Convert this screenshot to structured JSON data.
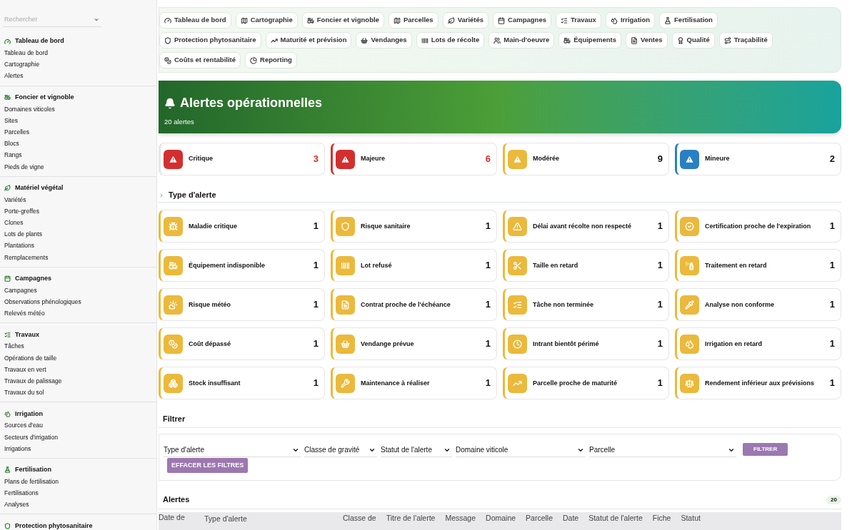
{
  "sidebar": {
    "search": {
      "placeholder": "Rechercher"
    },
    "sections": [
      {
        "title": "Tableau de bord",
        "items": [
          "Tableau de bord",
          "Cartographie",
          "Alertes"
        ]
      },
      {
        "title": "Foncier et vignoble",
        "items": [
          "Domaines viticoles",
          "Sites",
          "Parcelles",
          "Blocs",
          "Rangs",
          "Pieds de vigne"
        ]
      },
      {
        "title": "Matériel végétal",
        "items": [
          "Variétés",
          "Porte-greffes",
          "Clones",
          "Lots de plants",
          "Plantations",
          "Remplacements"
        ]
      },
      {
        "title": "Campagnes",
        "items": [
          "Campagnes",
          "Observations phénologiques",
          "Relevés météo"
        ]
      },
      {
        "title": "Travaux",
        "items": [
          "Tâches",
          "Opérations de taille",
          "Travaux en vert",
          "Travaux de palissage",
          "Travaux du sol"
        ]
      },
      {
        "title": "Irrigation",
        "items": [
          "Sources d'eau",
          "Secteurs d'irrigation",
          "Irrigations"
        ]
      },
      {
        "title": "Fertilisation",
        "items": [
          "Plans de fertilisation",
          "Fertilisations",
          "Analyses"
        ]
      },
      {
        "title": "Protection phytosanitaire"
      }
    ]
  },
  "nav": [
    "Tableau de bord",
    "Cartographie",
    "Foncier et vignoble",
    "Parcelles",
    "Variétés",
    "Campagnes",
    "Travaux",
    "Irrigation",
    "Fertilisation",
    "Protection phytosanitaire",
    "Maturité et prévision",
    "Vendanges",
    "Lots de récolte",
    "Main-d'oeuvre",
    "Équipements",
    "Ventes",
    "Qualité",
    "Traçabilité",
    "Coûts et rentabilité",
    "Reporting"
  ],
  "hero": {
    "title": "Alertes opérationnelles",
    "subtitle": "20 alertes"
  },
  "severities": [
    {
      "label": "Critique",
      "count": "3",
      "color": "#d32f2f",
      "highlighted": true
    },
    {
      "label": "Majeure",
      "count": "6",
      "color": "#d32f2f",
      "highlighted": true
    },
    {
      "label": "Modérée",
      "count": "9",
      "color": "#ebb93b",
      "highlighted": false
    },
    {
      "label": "Mineure",
      "count": "2",
      "color": "#2a7fc4",
      "highlighted": false
    }
  ],
  "types_heading": "Type d'alerte",
  "alert_types": [
    {
      "label": "Maladie critique",
      "count": "1"
    },
    {
      "label": "Risque sanitaire",
      "count": "1"
    },
    {
      "label": "Délai avant récolte non respecté",
      "count": "1"
    },
    {
      "label": "Certification proche de l'expiration",
      "count": "1"
    },
    {
      "label": "Équipement indisponible",
      "count": "1"
    },
    {
      "label": "Lot refusé",
      "count": "1"
    },
    {
      "label": "Taille en retard",
      "count": "1"
    },
    {
      "label": "Traitement en retard",
      "count": "1"
    },
    {
      "label": "Risque météo",
      "count": "1"
    },
    {
      "label": "Contrat proche de l'échéance",
      "count": "1"
    },
    {
      "label": "Tâche non terminée",
      "count": "1"
    },
    {
      "label": "Analyse non conforme",
      "count": "1"
    },
    {
      "label": "Coût dépassé",
      "count": "1"
    },
    {
      "label": "Vendange prévue",
      "count": "1"
    },
    {
      "label": "Intrant bientôt périmé",
      "count": "1"
    },
    {
      "label": "Irrigation en retard",
      "count": "1"
    },
    {
      "label": "Stock insuffisant",
      "count": "1"
    },
    {
      "label": "Maintenance à réaliser",
      "count": "1"
    },
    {
      "label": "Parcelle proche de maturité",
      "count": "1"
    },
    {
      "label": "Rendement inférieur aux prévisions",
      "count": "1"
    }
  ],
  "filter": {
    "heading": "Filtrer",
    "selects": [
      "Type d'alerte",
      "Classe de gravité",
      "Statut de l'alerte",
      "Domaine viticole",
      "Parcelle"
    ],
    "apply": "FILTRER",
    "clear": "EFFACER LES FILTRES"
  },
  "alerts": {
    "heading": "Alertes",
    "count": "20",
    "columns": [
      "Date de",
      "Type d'alerte",
      "Classe de",
      "Titre de l'alerte",
      "Message",
      "Domaine",
      "Parcelle",
      "Date",
      "Statut de l'alerte",
      "Fiche",
      "Statut"
    ]
  }
}
